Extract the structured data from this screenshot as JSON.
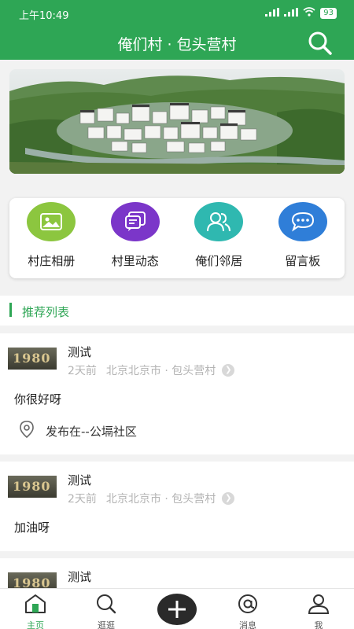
{
  "status": {
    "time": "上午10:49",
    "battery": "93"
  },
  "header": {
    "title": "俺们村 · 包头营村"
  },
  "quick_menu": [
    {
      "label": "村庄相册",
      "icon": "photo-album-icon",
      "color": "#8cc63f"
    },
    {
      "label": "村里动态",
      "icon": "chat-news-icon",
      "color": "#7b36c9"
    },
    {
      "label": "俺们邻居",
      "icon": "people-icon",
      "color": "#2fb8b0"
    },
    {
      "label": "留言板",
      "icon": "message-board-icon",
      "color": "#2f7ed8"
    }
  ],
  "section": {
    "title": "推荐列表"
  },
  "posts": [
    {
      "thumb": "1980",
      "name": "测试",
      "time": "2天前",
      "place": "北京北京市 · 包头营村",
      "content": "你很好呀",
      "location": "发布在--公塥社区"
    },
    {
      "thumb": "1980",
      "name": "测试",
      "time": "2天前",
      "place": "北京北京市 · 包头营村",
      "content": "加油呀"
    },
    {
      "thumb": "1980",
      "name": "测试"
    }
  ],
  "tabs": [
    {
      "label": "主页",
      "icon": "home-icon"
    },
    {
      "label": "逛逛",
      "icon": "search-icon"
    },
    {
      "label": "",
      "icon": "plus-icon"
    },
    {
      "label": "消息",
      "icon": "at-icon"
    },
    {
      "label": "我",
      "icon": "person-icon"
    }
  ],
  "colors": {
    "brand": "#2ea655"
  }
}
